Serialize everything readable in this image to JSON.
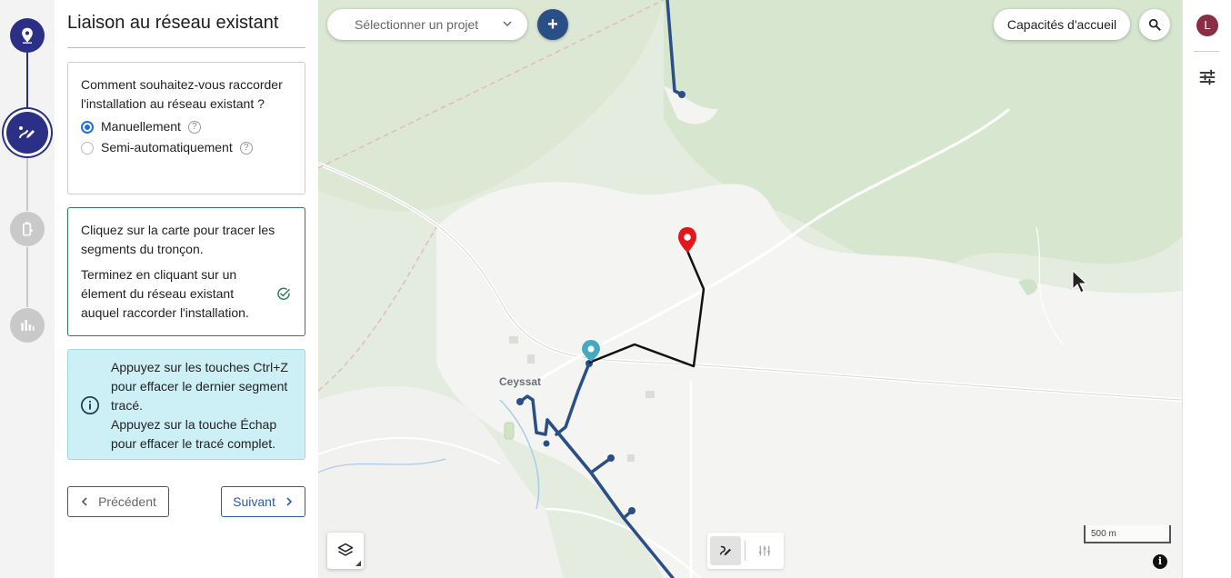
{
  "panel": {
    "title": "Liaison au réseau existant",
    "question": "Comment souhaitez-vous raccorder l'installation au réseau existant ?",
    "options": [
      {
        "label": "Manuellement",
        "selected": true
      },
      {
        "label": "Semi-automatiquement",
        "selected": false
      }
    ],
    "help_symbol": "?",
    "instruction_1": "Cliquez sur la carte pour tracer les segments du tronçon.",
    "instruction_2": "Terminez en cliquant sur un élement du réseau existant auquel raccorder l'installation.",
    "tip_1": "Appuyez sur les touches Ctrl+Z pour effacer le dernier segment tracé.",
    "tip_2": "Appuyez sur la touche Échap pour effacer le tracé complet.",
    "prev_label": "Précédent",
    "next_label": "Suivant"
  },
  "stepper": {
    "steps": [
      {
        "icon": "location-pin-icon",
        "state": "done"
      },
      {
        "icon": "pencil-route-icon",
        "state": "current"
      },
      {
        "icon": "battery-plug-icon",
        "state": "todo"
      },
      {
        "icon": "bar-chart-icon",
        "state": "todo"
      }
    ]
  },
  "map": {
    "project_placeholder": "Sélectionner un projet",
    "add_symbol": "+",
    "capacity_label": "Capacités d'accueil",
    "town_label": "Ceyssat",
    "scale_label": "500 m",
    "info_symbol": "i"
  },
  "user": {
    "initial": "L"
  },
  "colors": {
    "accent": "#2b2f86",
    "network_line": "#2a4f86",
    "drawn_line": "#111111",
    "start_marker": "#45a9c4",
    "end_marker": "#e3161b",
    "tip_background": "#cdeff6",
    "avatar": "#8a2d45"
  }
}
